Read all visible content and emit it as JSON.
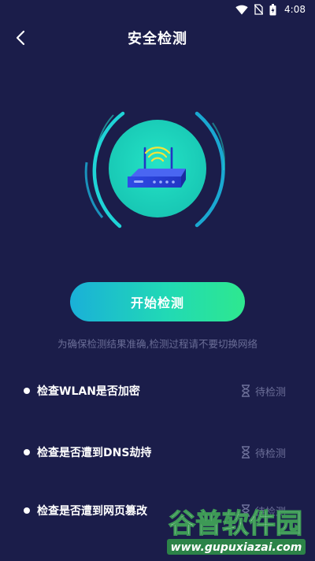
{
  "status_bar": {
    "time": "4:08",
    "icons": [
      "wifi-icon",
      "no-sim-icon",
      "battery-icon"
    ]
  },
  "header": {
    "back_icon": "chevron-left-icon",
    "title": "安全检测"
  },
  "hero": {
    "icon": "router-icon",
    "accent_colors": [
      "#1fe6d0",
      "#1ab0d8",
      "#2ee88f"
    ],
    "router_color": "#2a3fd6"
  },
  "start_button": {
    "label": "开始检测"
  },
  "hint": "为确保检测结果准确,检测过程请不要切换网络",
  "checks": [
    {
      "label": "检查WLAN是否加密",
      "status": "待检测",
      "status_icon": "hourglass-icon"
    },
    {
      "label": "检查是否遭到DNS劫持",
      "status": "待检测",
      "status_icon": "hourglass-icon"
    },
    {
      "label": "检查是否遭到网页篡改",
      "status": "待检测",
      "status_icon": "hourglass-icon"
    }
  ],
  "watermark": {
    "title": "谷普软件园",
    "url": "www.gupuxiazai.com"
  },
  "colors": {
    "background": "#1b1d4a",
    "hint_text": "#6a6d96",
    "status_text": "#6d7099"
  }
}
